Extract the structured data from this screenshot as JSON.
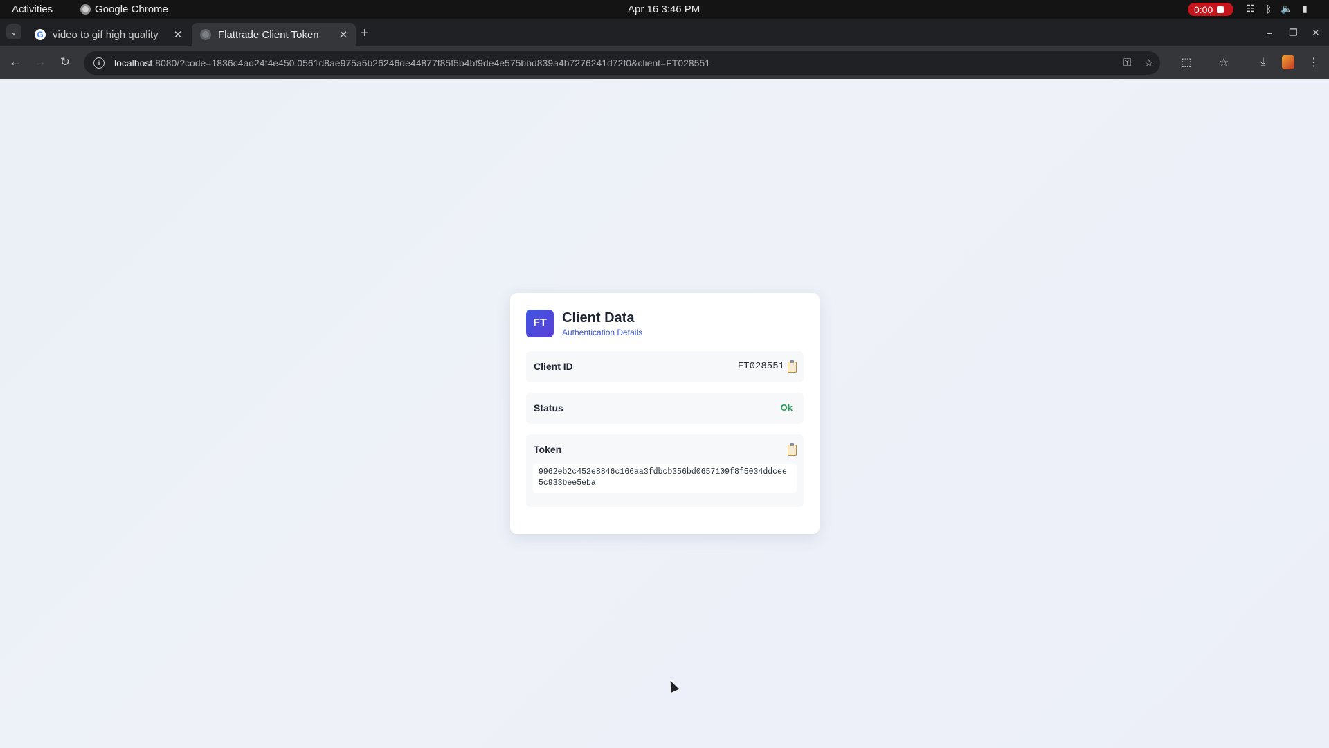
{
  "system_bar": {
    "activities": "Activities",
    "app_name": "Google Chrome",
    "clock": "Apr 16  3:46 PM",
    "recording_time": "0:00"
  },
  "browser": {
    "tabs": [
      {
        "title": "video to gif high quality",
        "active": false
      },
      {
        "title": "Flattrade Client Token",
        "active": true
      }
    ],
    "url_host": "localhost",
    "url_rest": ":8080/?code=1836c4ad24f4e450.0561d8ae975a5b26246de44877f85f5b4bf9de4e575bbd839a4b7276241d72f0&client=FT028551"
  },
  "card": {
    "badge": "FT",
    "title": "Client Data",
    "subtitle": "Authentication Details",
    "client_id_label": "Client ID",
    "client_id_value": "FT028551",
    "status_label": "Status",
    "status_value": "Ok",
    "token_label": "Token",
    "token_value": "9962eb2c452e8846c166aa3fdbcb356bd0657109f8f5034ddcee5c933bee5eba"
  },
  "colors": {
    "accent": "#3f58d8",
    "status_ok": "#2aa15a",
    "badge_bg": "#3f56e0"
  }
}
